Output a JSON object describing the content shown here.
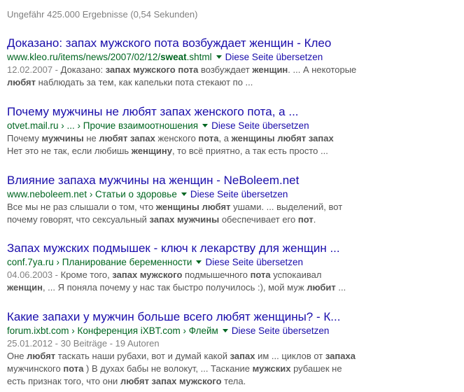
{
  "stats": "Ungefähr 425.000 Ergebnisse (0,54 Sekunden)",
  "translate_label": "Diese Seite übersetzen",
  "results": [
    {
      "title": "Доказано: запах мужского пота возбуждает женщин - Клео",
      "url_pre": "www.kleo.ru/items/news/2007/02/12/",
      "url_bold": "sweat",
      "url_post": ".shtml",
      "snippet_line1": [
        {
          "t": "12.02.2007 - ",
          "c": "date"
        },
        {
          "t": "Доказано: "
        },
        {
          "t": "запах мужского пота",
          "b": true
        },
        {
          "t": " возбуждает "
        },
        {
          "t": "женщин",
          "b": true
        },
        {
          "t": ". ... А некоторые"
        }
      ],
      "snippet_line2": [
        {
          "t": "любят",
          "b": true
        },
        {
          "t": " наблюдать за тем, как капельки пота стекают по ..."
        }
      ]
    },
    {
      "title": "Почему мужчины не любят запах женского пота, а ...",
      "url_pre": "otvet.mail.ru › ... › Прочие взаимоотношения",
      "url_bold": "",
      "url_post": "",
      "snippet_line1": [
        {
          "t": "Почему "
        },
        {
          "t": "мужчины",
          "b": true
        },
        {
          "t": " не "
        },
        {
          "t": "любят запах",
          "b": true
        },
        {
          "t": " женского "
        },
        {
          "t": "пота",
          "b": true
        },
        {
          "t": ", а "
        },
        {
          "t": "женщины любят запах",
          "b": true
        }
      ],
      "snippet_line2": [
        {
          "t": "Нет это не так, если любишь "
        },
        {
          "t": "женщину",
          "b": true
        },
        {
          "t": ", то всё приятно, а так есть просто ..."
        }
      ]
    },
    {
      "title": "Влияние запаха мужчины на женщин - NeBoleem.net",
      "url_pre": "www.neboleem.net › Статьи о здоровье",
      "url_bold": "",
      "url_post": "",
      "snippet_line1": [
        {
          "t": "Все мы не раз слышали о том, что "
        },
        {
          "t": "женщины любят",
          "b": true
        },
        {
          "t": " ушами. ... выделений, вот"
        }
      ],
      "snippet_line2": [
        {
          "t": "почему говорят, что сексуальный "
        },
        {
          "t": "запах мужчины",
          "b": true
        },
        {
          "t": " обеспечивает его "
        },
        {
          "t": "пот",
          "b": true
        },
        {
          "t": "."
        }
      ]
    },
    {
      "title": "Запах мужских подмышек - ключ к лекарству для женщин ...",
      "url_pre": "conf.7ya.ru › Планирование беременности",
      "url_bold": "",
      "url_post": "",
      "snippet_line1": [
        {
          "t": "04.06.2003 - ",
          "c": "date"
        },
        {
          "t": "Кроме того, "
        },
        {
          "t": "запах мужского",
          "b": true
        },
        {
          "t": " подмышечного "
        },
        {
          "t": "пота",
          "b": true
        },
        {
          "t": " успокаивал"
        }
      ],
      "snippet_line2": [
        {
          "t": "женщин",
          "b": true
        },
        {
          "t": ", ... Я поняла почему у нас так быстро получилось :), мой муж "
        },
        {
          "t": "любит",
          "b": true
        },
        {
          "t": " ..."
        }
      ]
    },
    {
      "title": "Какие запахи у мужчин больше всего любят женщины? - К...",
      "url_pre": "forum.ixbt.com › Конференция iXBT.com › Флейм",
      "url_bold": "",
      "url_post": "",
      "snippet_line0": [
        {
          "t": "25.01.2012 - 30 Beiträge - 19 Autoren",
          "c": "date"
        }
      ],
      "snippet_line1": [
        {
          "t": "Оне "
        },
        {
          "t": "любят",
          "b": true
        },
        {
          "t": " таскать наши рубахи, вот и думай какой "
        },
        {
          "t": "запах",
          "b": true
        },
        {
          "t": " им ... циклов от "
        },
        {
          "t": "запаха",
          "b": true
        }
      ],
      "snippet_line2": [
        {
          "t": "мужчинского "
        },
        {
          "t": "пота",
          "b": true
        },
        {
          "t": " ) В духах бабы не волокут, ... Таскание "
        },
        {
          "t": "мужских",
          "b": true
        },
        {
          "t": " рубашек не"
        }
      ],
      "snippet_line3": [
        {
          "t": "есть признак того, что они "
        },
        {
          "t": "любят запах мужского",
          "b": true
        },
        {
          "t": " тела."
        }
      ]
    }
  ]
}
